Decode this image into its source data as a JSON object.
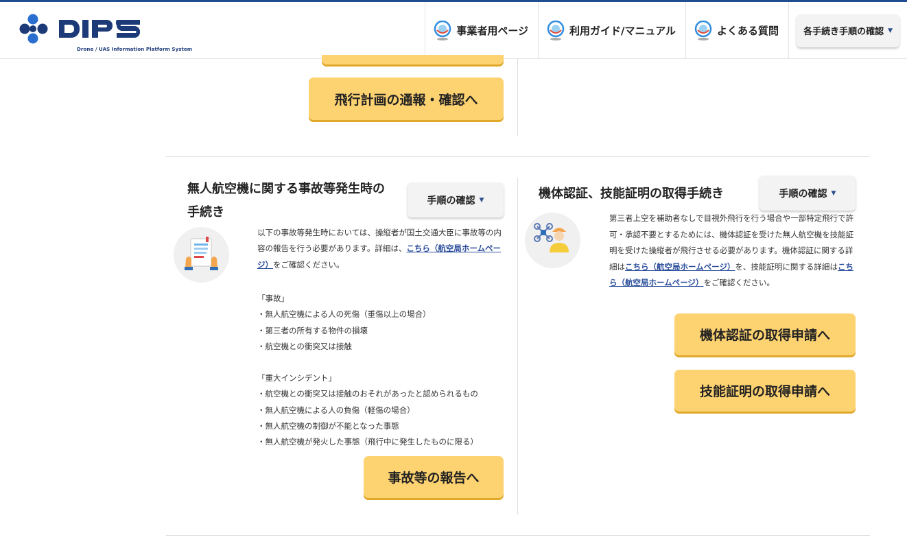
{
  "header": {
    "logo_text": "DIPS",
    "logo_subtitle": "Drone / UAS Information Platform System",
    "nav": [
      {
        "label": "事業者用ページ",
        "icon": "drone-logo-icon"
      },
      {
        "label": "利用ガイド/マニュアル",
        "icon": "drone-logo-icon"
      },
      {
        "label": "よくある質問",
        "icon": "drone-logo-icon"
      }
    ],
    "procedures_dropdown": "各手続き手順の確認"
  },
  "top": {
    "flight_plan_button": "飛行計画の通報・確認へ"
  },
  "accident": {
    "title_line1": "無人航空機に関する事故等発生時の",
    "title_line2": "手続き",
    "steps_button": "手順の確認",
    "icon": "report-document-icon",
    "intro_1": "以下の事故等発生時においては、操縦者が国土交通大臣に事故等の内容の報告を行う必要があります。詳細は、",
    "intro_link": "こちら（航空局ホームページ）",
    "intro_2": "をご確認ください。",
    "accident_heading": "「事故」",
    "accident_items": [
      "・無人航空機による人の死傷（重傷以上の場合）",
      "・第三者の所有する物件の損壊",
      "・航空機との衝突又は接触"
    ],
    "incident_heading": "「重大インシデント」",
    "incident_items": [
      "・航空機との衝突又は接触のおそれがあったと認められるもの",
      "・無人航空機による人の負傷（軽傷の場合）",
      "・無人航空機の制御が不能となった事態",
      "・無人航空機が発火した事態（飛行中に発生したものに限る）"
    ],
    "report_button": "事故等の報告へ"
  },
  "certification": {
    "title": "機体認証、技能証明の取得手続き",
    "steps_button": "手順の確認",
    "icon": "drone-pilot-icon",
    "text_1": "第三者上空を補助者なしで目視外飛行を行う場合や一部特定飛行で許可・承認不要とするためには、機体認証を受けた無人航空機を技能証明を受けた操縦者が飛行させる必要があります。機体認証に関する詳細は",
    "link_1": "こちら（航空局ホームページ）",
    "text_2": "を、技能証明に関する詳細は",
    "link_2": "こちら（航空局ホームページ）",
    "text_3": "をご確認ください。",
    "airframe_button": "機体認証の取得申請へ",
    "license_button": "技能証明の取得申請へ"
  },
  "colors": {
    "brand_blue": "#1e4d91",
    "button_yellow": "#fdd271",
    "link_blue": "#2a4d9b"
  }
}
